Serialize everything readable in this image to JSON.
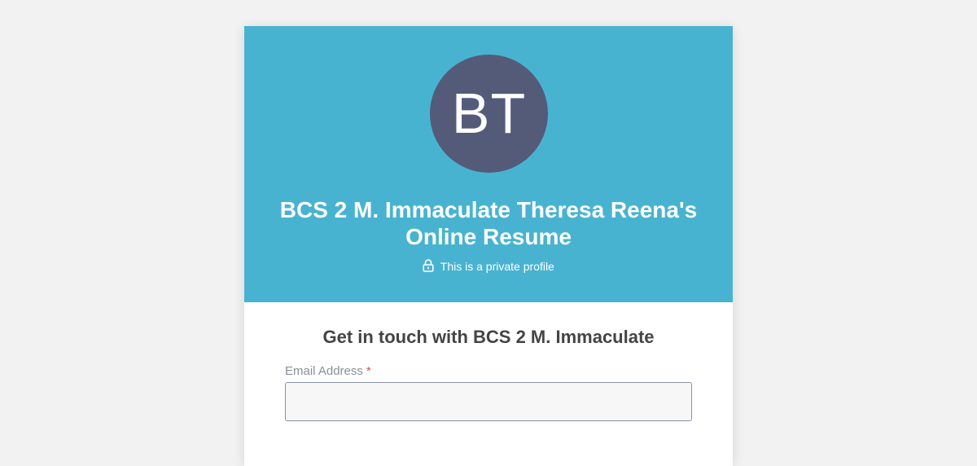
{
  "profile": {
    "initials": "BT",
    "title": "BCS 2 M. Immaculate Theresa Reena's Online Resume",
    "privacy_text": "This is a private profile",
    "privacy_icon": "lock-icon"
  },
  "contact": {
    "heading": "Get in touch with BCS 2 M. Immaculate",
    "email_label": "Email Address",
    "required_marker": "*",
    "email_value": "",
    "email_placeholder": ""
  },
  "colors": {
    "page_background": "#f2f2f2",
    "hero_background": "#48b3d1",
    "avatar_background": "#535b78",
    "required_marker": "#d9534f"
  }
}
